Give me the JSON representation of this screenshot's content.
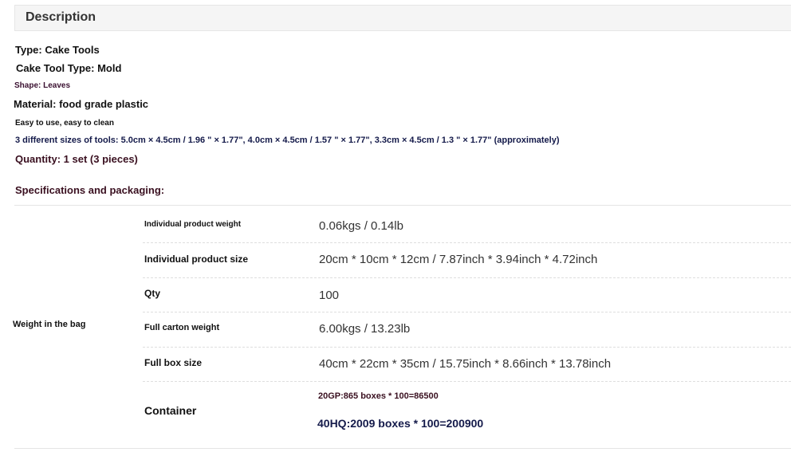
{
  "header": {
    "title": "Description"
  },
  "description": {
    "lines": [
      "Type: Cake Tools",
      "Cake Tool Type: Mold",
      "Shape: Leaves",
      "Material: food grade plastic",
      "Easy to use, easy to clean",
      "3 different sizes of tools: 5.0cm × 4.5cm / 1.96 \" × 1.77\", 4.0cm × 4.5cm / 1.57 \" × 1.77\", 3.3cm × 4.5cm / 1.3 \" × 1.77\" (approximately)",
      "Quantity: 1 set (3 pieces)"
    ],
    "spec_heading": "Specifications and packaging:"
  },
  "specs": {
    "group_label": "Weight in the bag",
    "rows": [
      {
        "label": "Individual product weight",
        "value": "0.06kgs / 0.14lb"
      },
      {
        "label": "Individual product size",
        "value": "20cm * 10cm * 12cm / 7.87inch * 3.94inch * 4.72inch"
      },
      {
        "label": "Qty",
        "value": "100"
      },
      {
        "label": "Full carton weight",
        "value": "6.00kgs / 13.23lb"
      },
      {
        "label": "Full box size",
        "value": "40cm * 22cm * 35cm / 15.75inch * 8.66inch * 13.78inch"
      }
    ],
    "container": {
      "label": "Container",
      "values": [
        "20GP:865 boxes * 100=86500",
        "40HQ:2009 boxes * 100=200900"
      ]
    }
  }
}
